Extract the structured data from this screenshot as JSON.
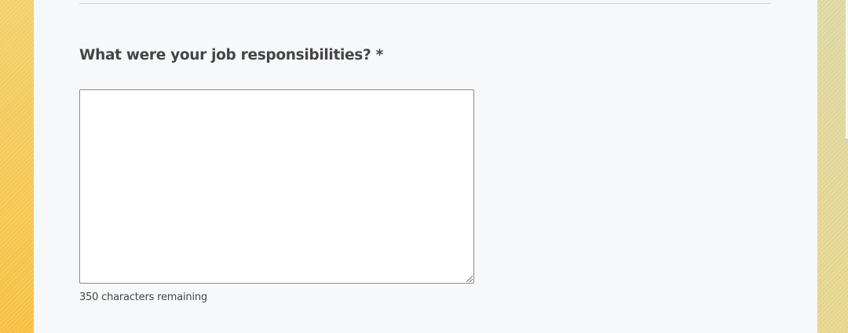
{
  "form": {
    "question_label": "What were your job responsibilities? *",
    "responsibilities_value": "",
    "char_counter_text": "350 characters remaining"
  },
  "icons": {
    "resize_handle": "resize-grip-icon"
  },
  "colors": {
    "panel_background": "#f7f8fa",
    "page_background_left": "#f6c248",
    "page_background_right": "#e1d694",
    "label_text": "#454545",
    "textarea_border": "#8a8a8a"
  }
}
